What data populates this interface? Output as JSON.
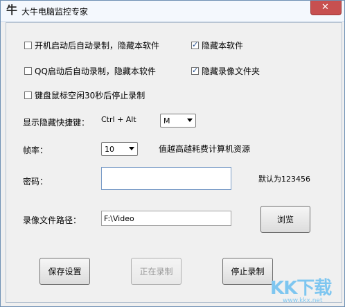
{
  "window": {
    "title": "大牛电脑监控专家",
    "app_icon": "牛",
    "close_icon": "✕"
  },
  "options": {
    "autostart_record": {
      "label": "开机启动后自动录制，隐藏本软件",
      "checked": false
    },
    "hide_software": {
      "label": "隐藏本软件",
      "checked": true
    },
    "qq_record": {
      "label": "QQ启动后自动录制，隐藏本软件",
      "checked": false
    },
    "hide_folder": {
      "label": "隐藏录像文件夹",
      "checked": true
    },
    "idle_stop": {
      "label": "键盘鼠标空闲30秒后停止录制",
      "checked": false
    }
  },
  "hotkey": {
    "label": "显示隐藏快捷键：",
    "modifier": "Ctrl + Alt",
    "key": "M"
  },
  "fps": {
    "label": "帧率：",
    "value": "10",
    "note": "值越高越耗费计算机资源"
  },
  "password": {
    "label": "密码：",
    "value": "",
    "default_note": "默认为123456"
  },
  "path": {
    "label": "录像文件路径：",
    "value": "F:\\Video",
    "browse": "浏览"
  },
  "actions": {
    "save": "保存设置",
    "recording": "正在录制",
    "stop": "停止录制"
  },
  "watermark": {
    "text": "KK下载",
    "url": "www.kkx.net"
  }
}
